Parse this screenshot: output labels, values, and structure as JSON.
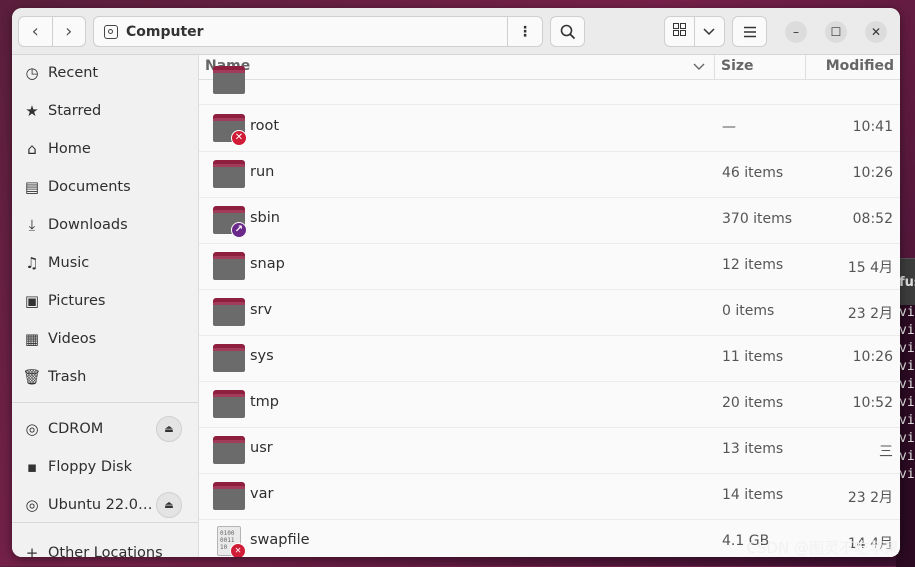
{
  "window": {
    "title": "Computer",
    "nav_back_icon": "chevron-left-icon",
    "nav_forward_icon": "chevron-right-icon",
    "minimize_glyph": "–",
    "maximize_glyph": "☐",
    "close_glyph": "✕"
  },
  "sidebar": {
    "places": [
      {
        "label": "Recent",
        "icon": "clock-icon"
      },
      {
        "label": "Starred",
        "icon": "star-icon"
      },
      {
        "label": "Home",
        "icon": "home-icon"
      },
      {
        "label": "Documents",
        "icon": "document-icon"
      },
      {
        "label": "Downloads",
        "icon": "download-icon"
      },
      {
        "label": "Music",
        "icon": "music-icon"
      },
      {
        "label": "Pictures",
        "icon": "picture-icon"
      },
      {
        "label": "Videos",
        "icon": "video-icon"
      },
      {
        "label": "Trash",
        "icon": "trash-icon"
      }
    ],
    "devices": [
      {
        "label": "CDROM",
        "icon": "disc-icon",
        "eject": true
      },
      {
        "label": "Floppy Disk",
        "icon": "floppy-icon",
        "eject": false
      },
      {
        "label": "Ubuntu 22.0…",
        "icon": "disc-icon",
        "eject": true
      }
    ],
    "other": {
      "label": "Other Locations",
      "icon": "plus-icon"
    }
  },
  "columns": {
    "name": "Name",
    "size": "Size",
    "modified": "Modified"
  },
  "rows": [
    {
      "name": "root",
      "size": "—",
      "modified": "10:41",
      "emblem": "x"
    },
    {
      "name": "run",
      "size": "46 items",
      "modified": "10:26",
      "emblem": ""
    },
    {
      "name": "sbin",
      "size": "370 items",
      "modified": "08:52",
      "emblem": "link"
    },
    {
      "name": "snap",
      "size": "12 items",
      "modified": "15 4月",
      "emblem": ""
    },
    {
      "name": "srv",
      "size": "0 items",
      "modified": "23 2月",
      "emblem": ""
    },
    {
      "name": "sys",
      "size": "11 items",
      "modified": "10:26",
      "emblem": ""
    },
    {
      "name": "tmp",
      "size": "20 items",
      "modified": "10:52",
      "emblem": ""
    },
    {
      "name": "usr",
      "size": "13 items",
      "modified": "三",
      "emblem": ""
    },
    {
      "name": "var",
      "size": "14 items",
      "modified": "23 2月",
      "emblem": ""
    },
    {
      "name": "swapfile",
      "size": "4.1 GB",
      "modified": "14 4月",
      "emblem": "x",
      "type": "file"
    }
  ],
  "background": {
    "terminal_title_fragment": "fus",
    "terminal_lines": [
      "vi",
      "vi",
      "vi",
      "vi",
      "vi",
      "vi",
      "vi",
      "vi",
      "vi",
      "vi"
    ]
  },
  "watermark": "CSDN @图灵不吃苹果"
}
